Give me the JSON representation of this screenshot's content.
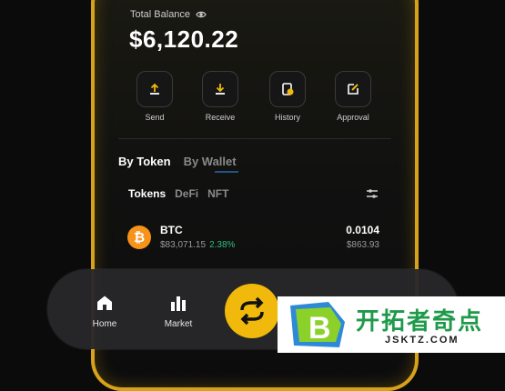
{
  "balance": {
    "label": "Total Balance",
    "value": "$6,120.22"
  },
  "actions": [
    {
      "label": "Send",
      "icon": "upload-icon"
    },
    {
      "label": "Receive",
      "icon": "download-icon"
    },
    {
      "label": "History",
      "icon": "history-icon"
    },
    {
      "label": "Approval",
      "icon": "approval-edit-icon"
    }
  ],
  "view_tabs": [
    {
      "label": "By Token",
      "active": true
    },
    {
      "label": "By Wallet",
      "active": false
    }
  ],
  "asset_tabs": [
    {
      "label": "Tokens",
      "active": true
    },
    {
      "label": "DeFi",
      "active": false
    },
    {
      "label": "NFT",
      "active": false
    }
  ],
  "tokens": [
    {
      "symbol": "BTC",
      "icon_glyph": "₿",
      "price": "$83,071.15",
      "change": "2.38%",
      "amount": "0.0104",
      "value_usd": "$863.93"
    }
  ],
  "nav": {
    "home_label": "Home",
    "market_label": "Market"
  },
  "watermark": {
    "letter": "B",
    "title": "开拓者奇点",
    "subtitle": "JSKTZ.COM"
  },
  "colors": {
    "accent": "#f0b90b",
    "positive": "#2ebd85",
    "btc": "#f7931a",
    "watermark_green": "#1f9a4a"
  }
}
